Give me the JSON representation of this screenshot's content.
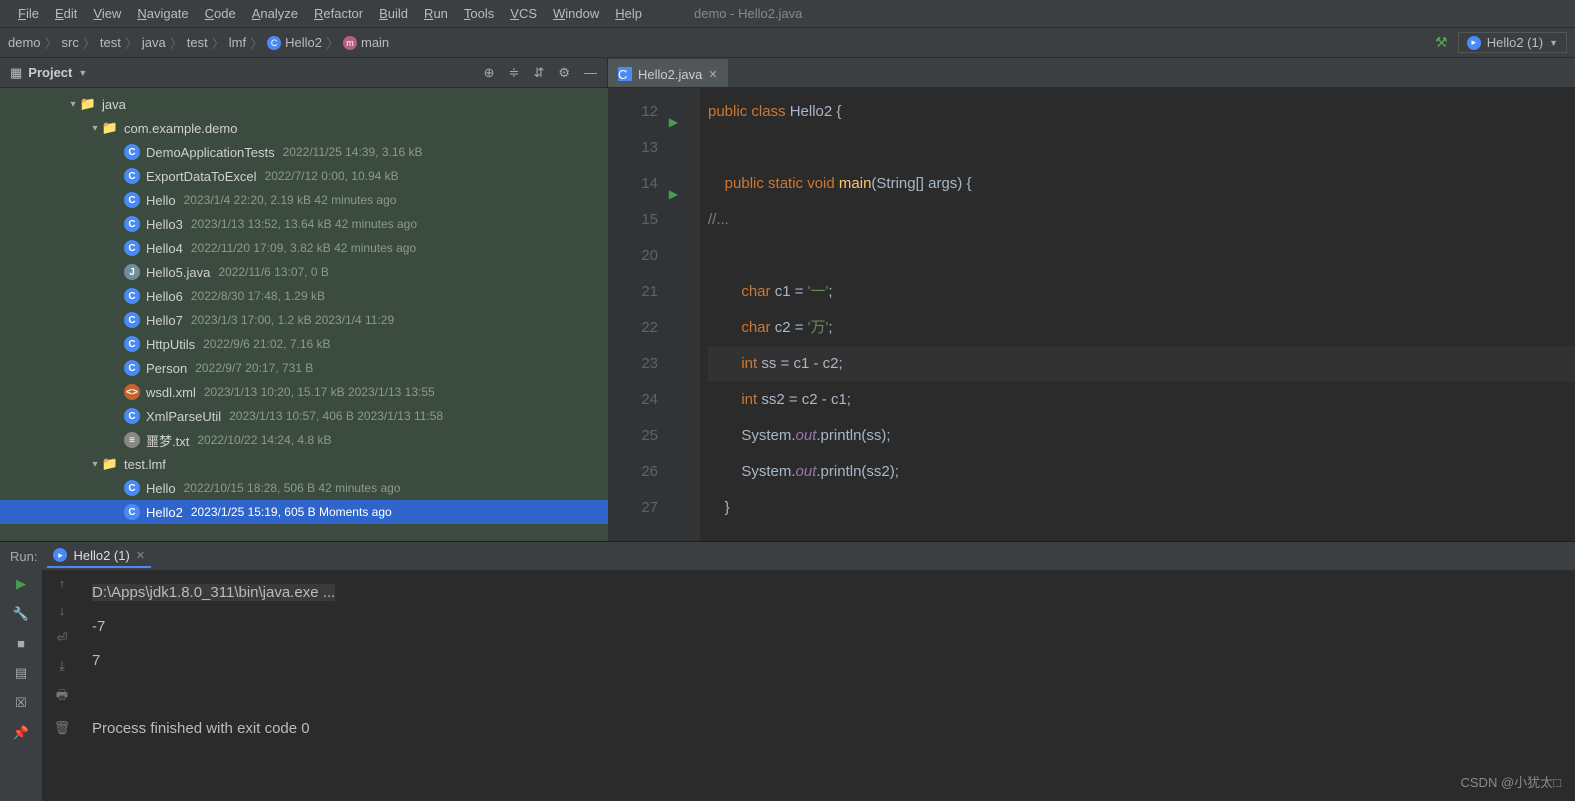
{
  "window_title": "demo - Hello2.java",
  "menu": [
    "File",
    "Edit",
    "View",
    "Navigate",
    "Code",
    "Analyze",
    "Refactor",
    "Build",
    "Run",
    "Tools",
    "VCS",
    "Window",
    "Help"
  ],
  "breadcrumbs": [
    {
      "label": "demo"
    },
    {
      "label": "src"
    },
    {
      "label": "test"
    },
    {
      "label": "java"
    },
    {
      "label": "test"
    },
    {
      "label": "lmf"
    },
    {
      "label": "Hello2",
      "icon": "class"
    },
    {
      "label": "main",
      "icon": "method"
    }
  ],
  "run_config": "Hello2 (1)",
  "project": {
    "label": "Project",
    "tree": [
      {
        "depth": 3,
        "chevron": "down",
        "icon": "folder",
        "name": "java"
      },
      {
        "depth": 4,
        "chevron": "down",
        "icon": "folder",
        "name": "com.example.demo"
      },
      {
        "depth": 5,
        "icon": "java",
        "name": "DemoApplicationTests",
        "meta": "2022/11/25 14:39, 3.16 kB"
      },
      {
        "depth": 5,
        "icon": "java",
        "name": "ExportDataToExcel",
        "meta": "2022/7/12 0:00, 10.94 kB"
      },
      {
        "depth": 5,
        "icon": "java",
        "name": "Hello",
        "meta": "2023/1/4 22:20, 2.19 kB 42 minutes ago"
      },
      {
        "depth": 5,
        "icon": "java",
        "name": "Hello3",
        "meta": "2023/1/13 13:52, 13.64 kB 42 minutes ago"
      },
      {
        "depth": 5,
        "icon": "java",
        "name": "Hello4",
        "meta": "2022/11/20 17:09, 3.82 kB 42 minutes ago"
      },
      {
        "depth": 5,
        "icon": "file",
        "name": "Hello5.java",
        "meta": "2022/11/6 13:07, 0 B"
      },
      {
        "depth": 5,
        "icon": "java",
        "name": "Hello6",
        "meta": "2022/8/30 17:48, 1.29 kB"
      },
      {
        "depth": 5,
        "icon": "java",
        "name": "Hello7",
        "meta": "2023/1/3 17:00, 1.2 kB 2023/1/4 11:29"
      },
      {
        "depth": 5,
        "icon": "java",
        "name": "HttpUtils",
        "meta": "2022/9/6 21:02, 7.16 kB"
      },
      {
        "depth": 5,
        "icon": "java",
        "name": "Person",
        "meta": "2022/9/7 20:17, 731 B"
      },
      {
        "depth": 5,
        "icon": "xml",
        "name": "wsdl.xml",
        "meta": "2023/1/13 10:20, 15.17 kB 2023/1/13 13:55"
      },
      {
        "depth": 5,
        "icon": "java",
        "name": "XmlParseUtil",
        "meta": "2023/1/13 10:57, 406 B 2023/1/13 11:58"
      },
      {
        "depth": 5,
        "icon": "txt",
        "name": "噩梦.txt",
        "meta": "2022/10/22 14:24, 4.8 kB"
      },
      {
        "depth": 4,
        "chevron": "down",
        "icon": "folder",
        "name": "test.lmf"
      },
      {
        "depth": 5,
        "icon": "java",
        "name": "Hello",
        "meta": "2022/10/15 18:28, 506 B 42 minutes ago"
      },
      {
        "depth": 5,
        "icon": "java",
        "name": "Hello2",
        "meta": "2023/1/25 15:19, 605 B Moments ago",
        "selected": true
      }
    ]
  },
  "editor": {
    "tab": "Hello2.java",
    "lines": [
      {
        "n": 12,
        "run": true,
        "html": "<span class='kw'>public class</span> <span class='pln'>Hello2 {</span>"
      },
      {
        "n": 13,
        "html": ""
      },
      {
        "n": 14,
        "run": true,
        "html": "    <span class='kw'>public static void</span> <span class='fn'>main</span><span class='pln'>(String[] args) {</span>"
      },
      {
        "n": 15,
        "html": "<span class='cmt'>//...</span>"
      },
      {
        "n": 20,
        "html": ""
      },
      {
        "n": 21,
        "html": "        <span class='kw'>char</span> <span class='pln'>c1 = </span><span class='str'>'一'</span><span class='pln'>;</span>"
      },
      {
        "n": 22,
        "html": "        <span class='kw'>char</span> <span class='pln'>c2 = </span><span class='str'>'万'</span><span class='pln'>;</span>"
      },
      {
        "n": 23,
        "hl": true,
        "html": "        <span class='kw'>int</span> <span class='pln'>ss = c1 - c2;</span>"
      },
      {
        "n": 24,
        "html": "        <span class='kw'>int</span> <span class='pln'>ss2 = c2 - c1;</span>"
      },
      {
        "n": 25,
        "html": "        <span class='pln'>System.</span><span class='fld'>out</span><span class='pln'>.println(ss);</span>"
      },
      {
        "n": 26,
        "html": "        <span class='pln'>System.</span><span class='fld'>out</span><span class='pln'>.println(ss2);</span>"
      },
      {
        "n": 27,
        "html": "    <span class='pln'>}</span>"
      }
    ]
  },
  "run": {
    "label": "Run:",
    "tab": "Hello2 (1)",
    "lines": [
      {
        "cmd": true,
        "text": "D:\\Apps\\jdk1.8.0_311\\bin\\java.exe ..."
      },
      {
        "text": "-7"
      },
      {
        "text": "7"
      },
      {
        "text": ""
      },
      {
        "text": "Process finished with exit code 0"
      }
    ]
  },
  "watermark": "CSDN @小犹太□"
}
